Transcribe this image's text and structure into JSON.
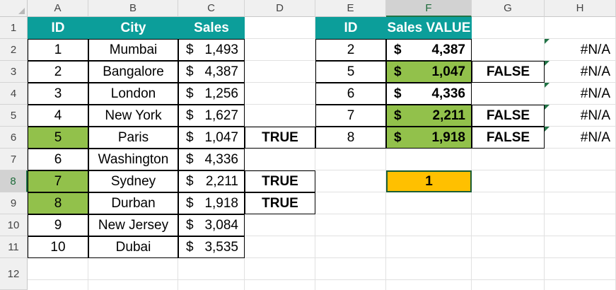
{
  "columns": [
    "A",
    "B",
    "C",
    "D",
    "E",
    "F",
    "G",
    "H"
  ],
  "rows": [
    "1",
    "2",
    "3",
    "4",
    "5",
    "6",
    "7",
    "8",
    "9",
    "10",
    "11",
    "12"
  ],
  "table1": {
    "headers": {
      "id": "ID",
      "city": "City",
      "sales": "Sales"
    },
    "currency": "$",
    "records": [
      {
        "id": "1",
        "city": "Mumbai",
        "sales": "1,493",
        "match": ""
      },
      {
        "id": "2",
        "city": "Bangalore",
        "sales": "4,387",
        "match": ""
      },
      {
        "id": "3",
        "city": "London",
        "sales": "1,256",
        "match": ""
      },
      {
        "id": "4",
        "city": "New York",
        "sales": "1,627",
        "match": ""
      },
      {
        "id": "5",
        "city": "Paris",
        "sales": "1,047",
        "match": "TRUE"
      },
      {
        "id": "6",
        "city": "Washington",
        "sales": "4,336",
        "match": ""
      },
      {
        "id": "7",
        "city": "Sydney",
        "sales": "2,211",
        "match": "TRUE"
      },
      {
        "id": "8",
        "city": "Durban",
        "sales": "1,918",
        "match": "TRUE"
      },
      {
        "id": "9",
        "city": "New Jersey",
        "sales": "3,084",
        "match": ""
      },
      {
        "id": "10",
        "city": "Dubai",
        "sales": "3,535",
        "match": ""
      }
    ]
  },
  "table2": {
    "headers": {
      "id": "ID",
      "sales_value": "Sales VALUE"
    },
    "currency": "$",
    "records": [
      {
        "id": "2",
        "sales_value": "4,387",
        "result": "",
        "na": "#N/A"
      },
      {
        "id": "5",
        "sales_value": "1,047",
        "result": "FALSE",
        "na": "#N/A"
      },
      {
        "id": "6",
        "sales_value": "4,336",
        "result": "",
        "na": "#N/A"
      },
      {
        "id": "7",
        "sales_value": "2,211",
        "result": "FALSE",
        "na": "#N/A"
      },
      {
        "id": "8",
        "sales_value": "1,918",
        "result": "FALSE",
        "na": "#N/A"
      }
    ]
  },
  "active_cell": {
    "ref": "F8",
    "value": "1"
  },
  "colors": {
    "header_fill": "#0c9e9a",
    "highlight_fill": "#92c14b",
    "active_fill": "#ffc000",
    "selection_accent": "#217346"
  }
}
